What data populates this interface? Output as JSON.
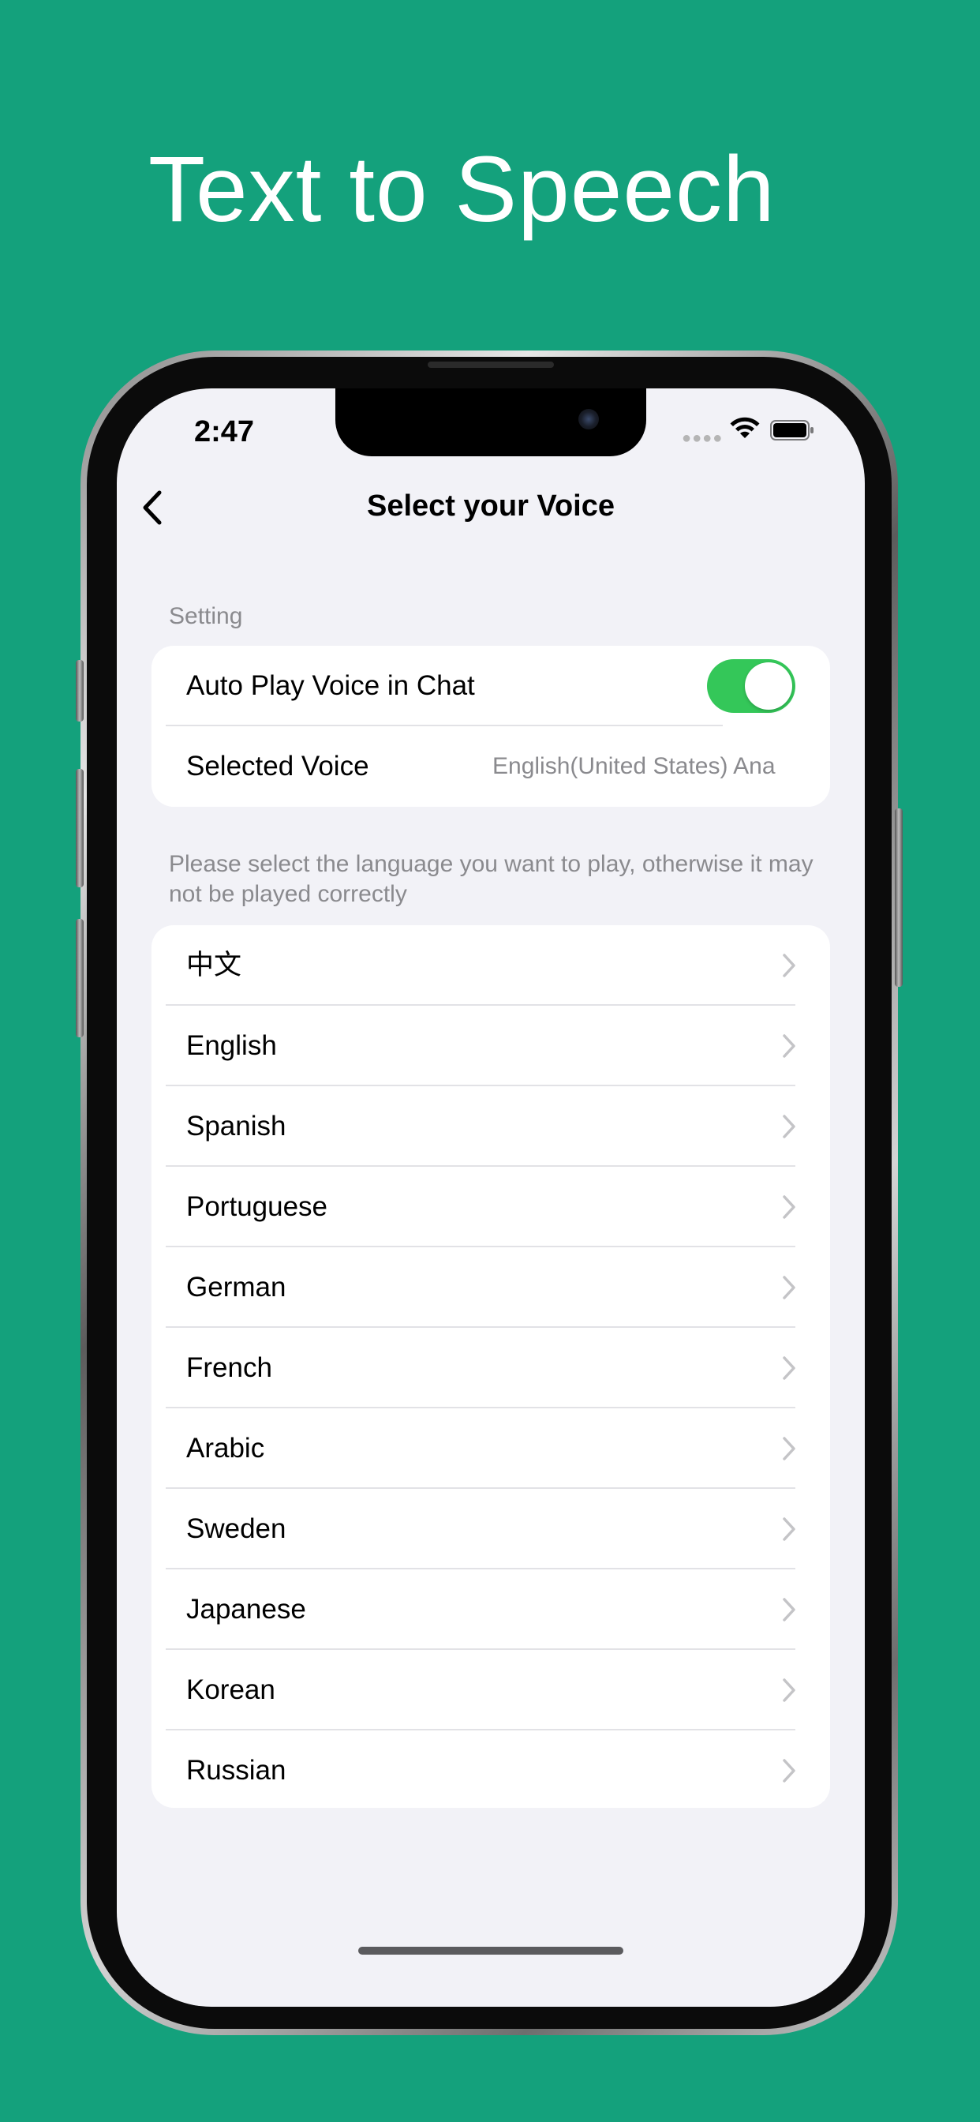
{
  "promo": {
    "title": "Text to Speech"
  },
  "status_bar": {
    "time": "2:47",
    "signal_icon": "signal-dots-icon",
    "wifi_icon": "wifi-icon",
    "battery_icon": "battery-icon"
  },
  "nav": {
    "title": "Select your Voice",
    "back_icon": "chevron-left-icon"
  },
  "settings": {
    "header": "Setting",
    "auto_play_label": "Auto Play Voice in Chat",
    "auto_play_on": true,
    "selected_voice_label": "Selected Voice",
    "selected_voice_value": "English(United States) Ana"
  },
  "note": "Please select the language you want to play, otherwise it may not be played correctly",
  "languages": [
    {
      "label": "中文"
    },
    {
      "label": "English"
    },
    {
      "label": "Spanish"
    },
    {
      "label": "Portuguese"
    },
    {
      "label": "German"
    },
    {
      "label": "French"
    },
    {
      "label": "Arabic"
    },
    {
      "label": "Sweden"
    },
    {
      "label": "Japanese"
    },
    {
      "label": "Korean"
    },
    {
      "label": "Russian"
    }
  ],
  "colors": {
    "background": "#14a17c",
    "toggle_on": "#34c759",
    "screen_bg": "#f2f2f7",
    "secondary_text": "#8a8a8e"
  }
}
